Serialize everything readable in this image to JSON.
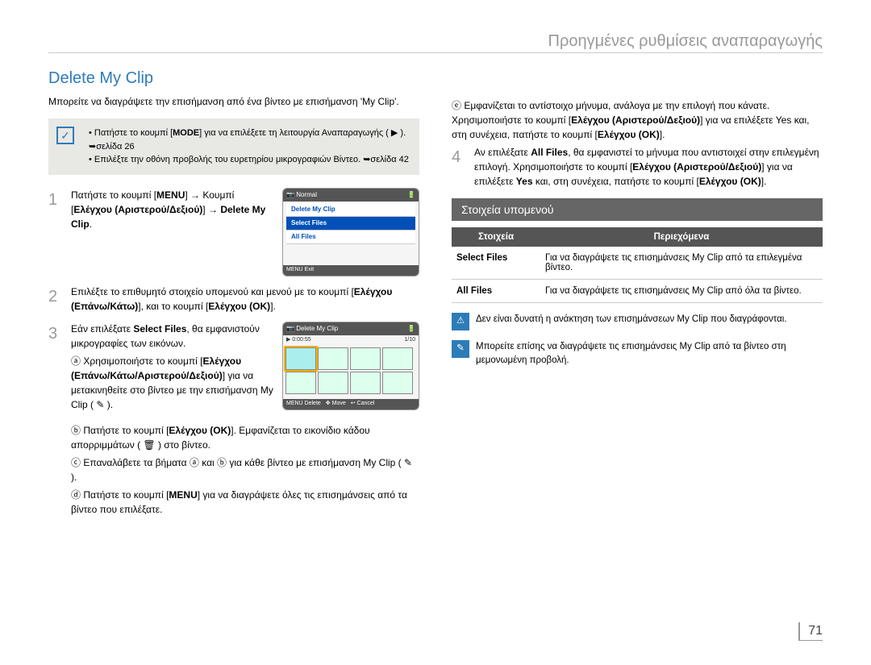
{
  "header": {
    "title": "Προηγμένες ρυθμίσεις αναπαραγωγής"
  },
  "section": {
    "title": "Delete My Clip"
  },
  "intro": "Μπορείτε να διαγράψετε την επισήμανση από ένα βίντεο με επισήμανση 'My Clip'.",
  "notebox": {
    "line1_a": "Πατήστε το κουμπί [",
    "line1_b": "MODE",
    "line1_c": "] για να επιλέξετε τη λειτουργία Αναπαραγωγής ( ▶ ). ➥σελίδα 26",
    "line2": "Επιλέξτε την οθόνη προβολής του ευρετηρίου μικρογραφιών Βίντεο. ➥σελίδα 42"
  },
  "steps": {
    "s1": {
      "num": "1",
      "a": "Πατήστε το κουμπί [",
      "b": "MENU",
      "c": "] → Κουμπί [",
      "d": "Ελέγχου (Αριστερού/Δεξιού)",
      "e": "] → ",
      "f": "Delete My Clip",
      "g": "."
    },
    "s2": {
      "num": "2",
      "a": "Επιλέξτε το επιθυμητό στοιχείο υπομενού και μενού με το κουμπί [",
      "b": "Ελέγχου (Επάνω/Κάτω)",
      "c": "], και το κουμπί [",
      "d": "Ελέγχου (OK)",
      "e": "]."
    },
    "s3": {
      "num": "3",
      "a": "Εάν επιλέξατε ",
      "b": "Select Files",
      "c": ", θα εμφανιστούν μικρογραφίες των εικόνων."
    },
    "s3a": {
      "label": "ⓐ",
      "a": "Χρησιμοποιήστε το κουμπί [",
      "b": "Ελέγχου (Επάνω/Κάτω/Αριστερού/Δεξιού)",
      "c": "] για να μετακινηθείτε στο βίντεο με την επισήμανση My Clip ( ✎ )."
    },
    "s3b": {
      "label": "ⓑ",
      "a": "Πατήστε το κουμπί [",
      "b": "Ελέγχου (OK)",
      "c": "]. Εμφανίζεται το εικονίδιο κάδου απορριμμάτων ( 🗑 ) στο βίντεο."
    },
    "s3c": {
      "label": "ⓒ",
      "text": "Επαναλάβετε τα βήματα ⓐ και ⓑ για κάθε βίντεο με επισήμανση My Clip ( ✎ )."
    },
    "s3d": {
      "label": "ⓓ",
      "a": "Πατήστε το κουμπί [",
      "b": "MENU",
      "c": "] για να διαγράψετε όλες τις επισημάνσεις από τα βίντεο που επιλέξατε."
    },
    "s3e": {
      "label": "ⓔ",
      "a": "Εμφανίζεται το αντίστοιχο μήνυμα, ανάλογα με την επιλογή που κάνατε. Χρησιμοποιήστε το κουμπί [",
      "b": "Ελέγχου (Αριστερού/Δεξιού)",
      "c": "] για να επιλέξετε Yes και, στη συνέχεια, πατήστε το κουμπί [",
      "d": "Ελέγχου (OK)",
      "e": "]."
    },
    "s4": {
      "num": "4",
      "a": "Αν επιλέξατε ",
      "b": "All Files",
      "c": ", θα εμφανιστεί το μήνυμα που αντιστοιχεί στην επιλεγμένη επιλογή. Χρησιμοποιήστε το κουμπί [",
      "d": "Ελέγχου (Αριστερού/Δεξιού)",
      "e": "] για να επιλέξετε ",
      "f": "Yes",
      "g": " και, στη συνέχεια, πατήστε το κουμπί [",
      "h": "Ελέγχου (OK)",
      "i": "]."
    }
  },
  "screen1": {
    "top": "Normal",
    "delete": "Delete My Clip",
    "select": "Select Files",
    "all": "All Files",
    "exit": "MENU  Exit"
  },
  "screen2": {
    "top": "Delete My Clip",
    "time": "0:00:55",
    "count": "1/10",
    "delete": "MENU Delete",
    "move": "Move",
    "cancel": "Cancel"
  },
  "submenu": {
    "title": "Στοιχεία υπομενού",
    "th1": "Στοιχεία",
    "th2": "Περιεχόμενα",
    "row1_a": "Select Files",
    "row1_b": "Για να διαγράψετε τις επισημάνσεις My Clip από τα επιλεγμένα βίντεο.",
    "row2_a": "All Files",
    "row2_b": "Για να διαγράψετε τις επισημάνσεις My Clip από όλα τα βίντεο."
  },
  "info1": "Δεν είναι δυνατή η ανάκτηση των επισημάνσεων My Clip που διαγράφονται.",
  "info2": "Μπορείτε επίσης να διαγράψετε τις επισημάνσεις My Clip από τα βίντεο στη μεμονωμένη προβολή.",
  "page": "71"
}
